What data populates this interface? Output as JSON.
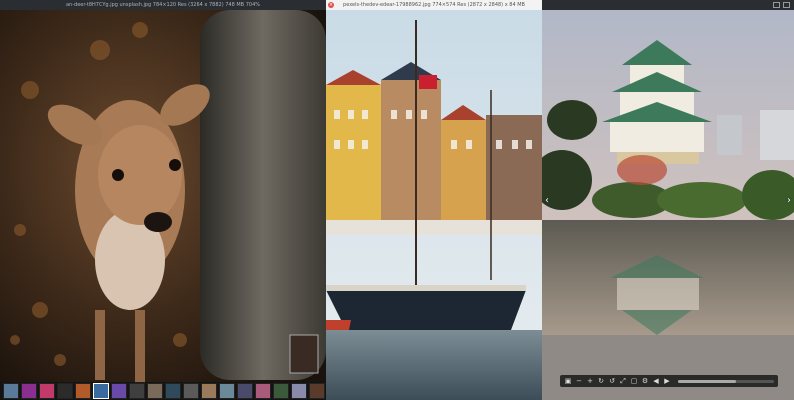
{
  "windows": [
    {
      "title": "an-deer-t8H7CYg.jpg unsplash.jpg 784×120 Res (3264 x 7882) 748 MB 704%"
    },
    {
      "title": "pexels-thedev-edear-17988962.jpg 774×574 Res (2872 x 2848) x 84 MB"
    },
    {
      "title": ""
    }
  ],
  "toolbar": {
    "icons": [
      "image-icon",
      "zoom-out-icon",
      "zoom-in-icon",
      "rotate-icon",
      "reset-icon",
      "fit-icon",
      "crop-icon",
      "settings-icon",
      "prev-icon",
      "next-icon"
    ],
    "zoom_fraction": 0.6
  },
  "nav": {
    "prev": "‹",
    "next": "›",
    "close": "×"
  },
  "thumbnails_count": 19,
  "colors": {
    "titlebar_dark": "#2a2d31",
    "titlebar_light": "#f3f3f3",
    "accent_close": "#e34c4c"
  }
}
